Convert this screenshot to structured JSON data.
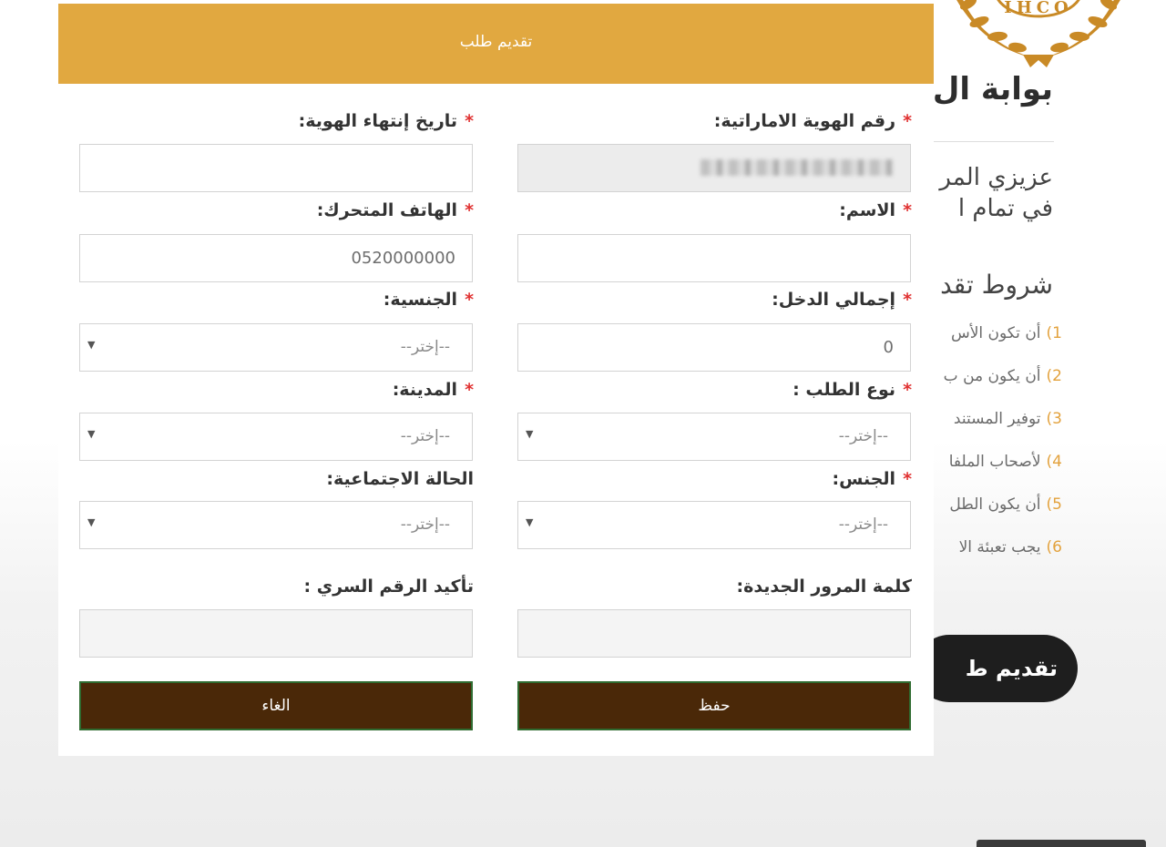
{
  "background_page": {
    "portal_title": "بوابة ال",
    "greeting_line1": "عزيزي المر",
    "greeting_line2": "في تمام ا",
    "conditions_title": "شروط تقد",
    "conditions": [
      {
        "num": "1)",
        "text": "أن تكون الأس"
      },
      {
        "num": "2)",
        "text": "أن يكون من ب"
      },
      {
        "num": "3)",
        "text": "توفير المستند"
      },
      {
        "num": "4)",
        "text": "لأصحاب الملفا"
      },
      {
        "num": "5)",
        "text": "أن يكون الطل"
      },
      {
        "num": "6)",
        "text": "يجب تعبئة الا"
      }
    ],
    "submit_label": "تقديم ط",
    "logo_text": "IHCO",
    "colors": {
      "accent": "#e3a23d",
      "dark_button": "#1e1e1e"
    }
  },
  "modal": {
    "title": "تقديم طلب",
    "colors": {
      "header": "#e1a840",
      "button": "#4a2808",
      "button_border": "#2f6b30",
      "required": "#e03131"
    },
    "fields": {
      "emirates_id": {
        "label": "رقم الهوية الاماراتية:",
        "required": true,
        "value": "",
        "disabled": true
      },
      "id_expiry": {
        "label": "تاريخ إنتهاء الهوية:",
        "required": true,
        "value": ""
      },
      "name": {
        "label": "الاسم:",
        "required": true,
        "value": ""
      },
      "mobile": {
        "label": "الهاتف المتحرك:",
        "required": true,
        "value": "",
        "placeholder": "0520000000"
      },
      "total_income": {
        "label": "إجمالي الدخل:",
        "required": true,
        "value": "0"
      },
      "nationality": {
        "label": "الجنسية:",
        "required": true,
        "selected": "--إختر--"
      },
      "request_type": {
        "label": "نوع الطلب :",
        "required": true,
        "selected": "--إختر--"
      },
      "city": {
        "label": "المدينة:",
        "required": true,
        "selected": "--إختر--"
      },
      "gender": {
        "label": "الجنس:",
        "required": true,
        "selected": "--إختر--"
      },
      "marital_status": {
        "label": "الحالة الاجتماعية:",
        "required": false,
        "selected": "--إختر--"
      },
      "new_password": {
        "label": "كلمة المرور الجديدة:",
        "required": false,
        "value": ""
      },
      "confirm_password": {
        "label": "تأكيد الرقم السري :",
        "required": false,
        "value": ""
      }
    },
    "required_mark": "*",
    "save_label": "حفظ",
    "cancel_label": "الغاء"
  }
}
